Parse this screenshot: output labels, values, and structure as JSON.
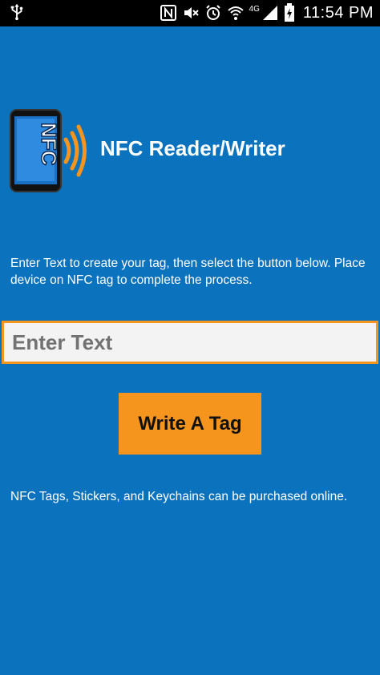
{
  "status_bar": {
    "time": "11:54 PM",
    "network": "4G",
    "icons": [
      "usb-icon",
      "nfc-icon",
      "mute-icon",
      "alarm-icon",
      "wifi-icon",
      "signal-icon",
      "battery-icon"
    ]
  },
  "app": {
    "title": "NFC Reader/Writer",
    "logo_text": "NFC"
  },
  "main": {
    "instructions": "Enter Text to create your tag, then select the button below. Place device on NFC tag to complete the process.",
    "input_placeholder": "Enter Text",
    "input_value": "",
    "write_button_label": "Write A Tag",
    "purchase_note": "NFC Tags, Stickers, and Keychains can be purchased online."
  },
  "colors": {
    "background": "#0b72bd",
    "accent": "#f6951d",
    "status_bar": "#000000"
  }
}
